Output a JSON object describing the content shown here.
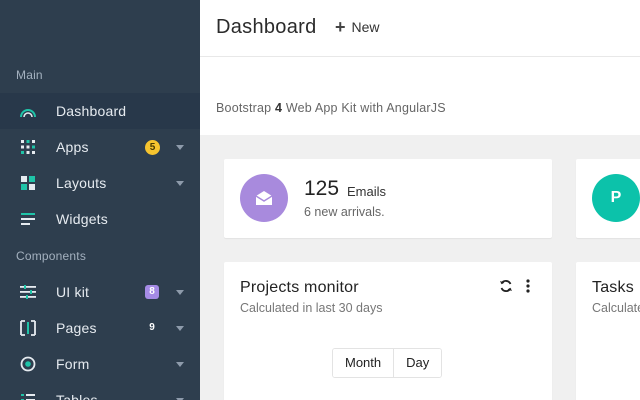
{
  "sidebar": {
    "sections": [
      {
        "label": "Main"
      },
      {
        "label": "Components"
      }
    ],
    "items": [
      {
        "label": "Dashboard",
        "icon": "dashboard-arc-icon"
      },
      {
        "label": "Apps",
        "icon": "grid-icon",
        "badge": "5"
      },
      {
        "label": "Layouts",
        "icon": "layout-icon"
      },
      {
        "label": "Widgets",
        "icon": "lines-icon"
      },
      {
        "label": "UI kit",
        "icon": "sliders-icon",
        "badge": "8"
      },
      {
        "label": "Pages",
        "icon": "pages-icon",
        "badge": "9"
      },
      {
        "label": "Form",
        "icon": "radio-icon"
      },
      {
        "label": "Tables",
        "icon": "table-icon"
      }
    ],
    "colors": {
      "background": "#2e3e4e",
      "active": "#28384a",
      "icon_teal": "#1fc4a8"
    }
  },
  "header": {
    "title": "Dashboard",
    "new_label": "New"
  },
  "subheader": {
    "prefix": "Bootstrap ",
    "version": "4",
    "suffix": " Web App Kit with AngularJS"
  },
  "cards": {
    "emails": {
      "count": "125",
      "unit": "Emails",
      "sub": "6 new arrivals.",
      "color": "#a88add"
    },
    "peek": {
      "avatar": "P",
      "color": "#0cc2aa"
    },
    "projects": {
      "title": "Projects monitor",
      "sub": "Calculated in last 30 days",
      "tabs": [
        "Month",
        "Day"
      ]
    },
    "tasks": {
      "title": "Tasks",
      "sub": "Calculate"
    }
  }
}
